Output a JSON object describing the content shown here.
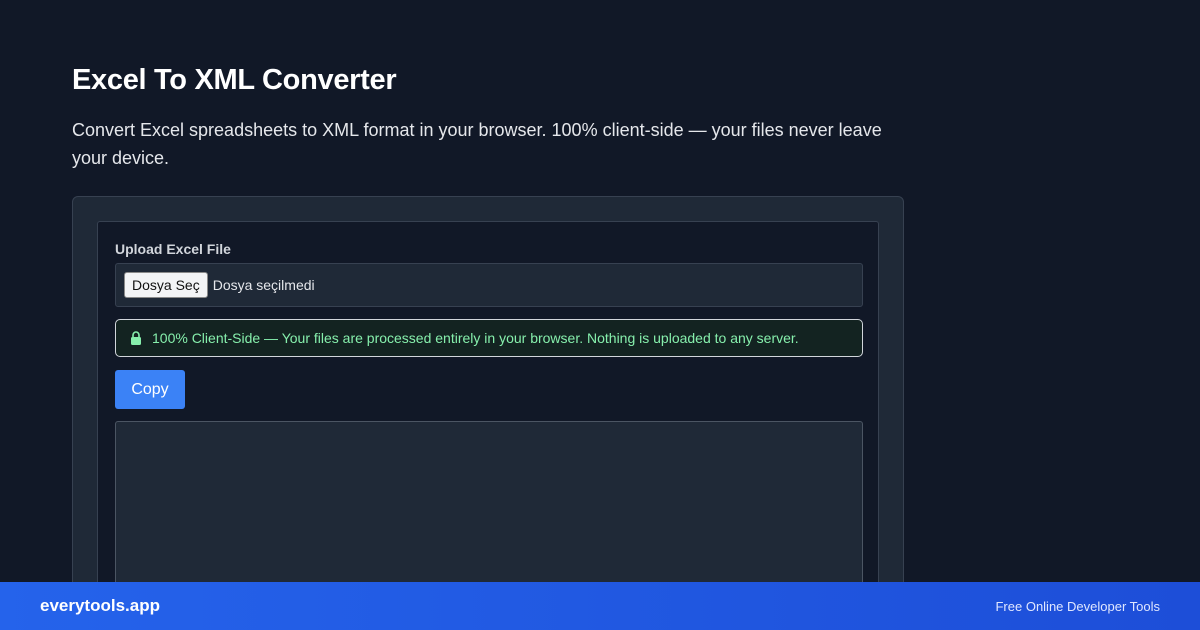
{
  "header": {
    "title": "Excel To XML Converter",
    "subtitle": "Convert Excel spreadsheets to XML format in your browser. 100% client-side — your files never leave your device."
  },
  "upload": {
    "label": "Upload Excel File",
    "button_label": "Dosya Seç",
    "status": "Dosya seçilmedi"
  },
  "notice": {
    "icon": "lock-icon",
    "text": "100% Client-Side — Your files are processed entirely in your browser. Nothing is uploaded to any server."
  },
  "actions": {
    "copy_label": "Copy"
  },
  "output": {
    "value": ""
  },
  "footer": {
    "brand": "everytools.app",
    "tagline": "Free Online Developer Tools"
  },
  "colors": {
    "background": "#111827",
    "card": "#1f2937",
    "accent": "#3b82f6",
    "notice_text": "#86efac",
    "footer": "#2563eb"
  }
}
